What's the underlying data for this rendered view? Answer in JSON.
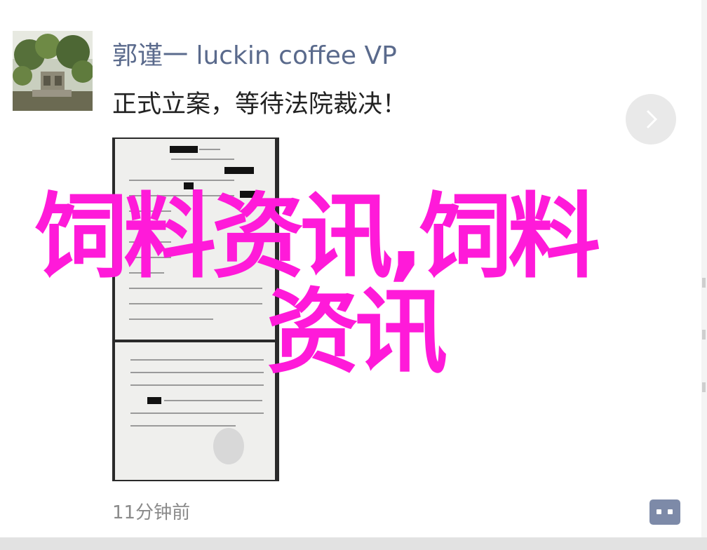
{
  "post": {
    "author": "郭谨一 luckin coffee VP",
    "text": "正式立案，等待法院裁决！",
    "time": "11分钟前"
  },
  "watermark": {
    "line1": "饲料资讯,饲料",
    "line2": "资讯"
  },
  "icons": {
    "next": "chevron-right-icon",
    "comment": "comment-icon"
  },
  "colors": {
    "author_name": "#5a6a8c",
    "watermark": "#ff1ad9",
    "comment_button": "#7d8aa8"
  }
}
